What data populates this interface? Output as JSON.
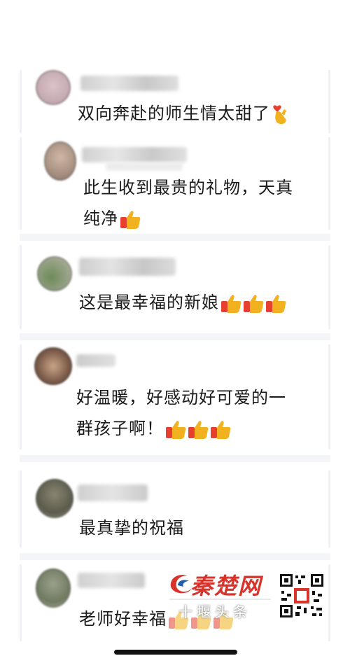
{
  "comments": [
    {
      "text_lines": [
        "双向奔赴的师生情太甜了"
      ],
      "emoji": "finger-heart-icon",
      "emoji_count": 1
    },
    {
      "text_lines": [
        "此生收到最贵的礼物，天真",
        "纯净"
      ],
      "emoji": "thumbs-up-icon",
      "emoji_count": 1
    },
    {
      "text_lines": [
        "这是最幸福的新娘"
      ],
      "emoji": "thumbs-up-icon",
      "emoji_count": 3
    },
    {
      "text_lines": [
        "好温暖，好感动好可爱的一",
        "群孩子啊！"
      ],
      "emoji": "thumbs-up-icon",
      "emoji_count": 3
    },
    {
      "text_lines": [
        "最真挚的祝福"
      ],
      "emoji": null,
      "emoji_count": 0
    },
    {
      "text_lines": [
        "老师好幸福"
      ],
      "emoji": "thumbs-up-icon",
      "emoji_count": 3
    }
  ],
  "watermark": {
    "brand": "秦楚网",
    "sub": "十堰头条",
    "brand_color": "#d9342b"
  },
  "colors": {
    "text": "#1a1a1a",
    "thumb": "#f2b21f",
    "sleeve": "#e8402f"
  }
}
